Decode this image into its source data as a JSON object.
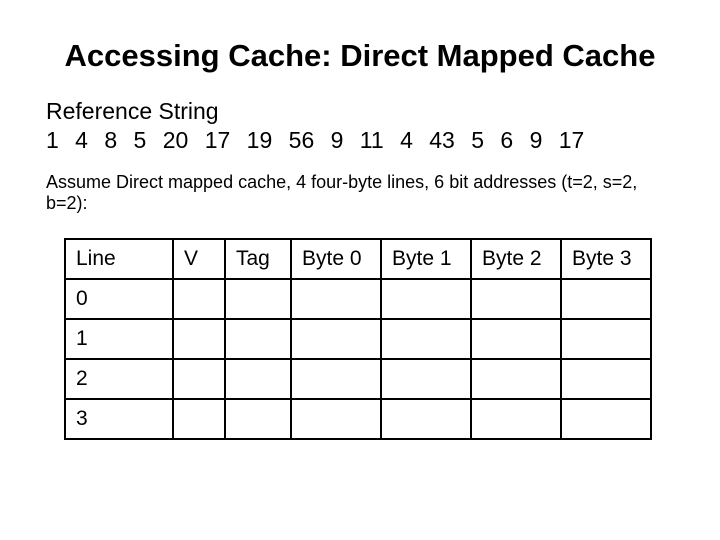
{
  "title": "Accessing Cache: Direct Mapped Cache",
  "reference": {
    "label": "Reference String",
    "values": "1  4  8  5  20  17  19  56  9  11  4  43  5  6  9  17"
  },
  "assume": "Assume Direct mapped cache, 4 four-byte lines, 6 bit addresses (t=2, s=2, b=2):",
  "table": {
    "headers": {
      "line": "Line",
      "v": "V",
      "tag": "Tag",
      "b0": "Byte 0",
      "b1": "Byte 1",
      "b2": "Byte 2",
      "b3": "Byte 3"
    },
    "rows": [
      {
        "line": "0",
        "v": "",
        "tag": "",
        "b0": "",
        "b1": "",
        "b2": "",
        "b3": ""
      },
      {
        "line": "1",
        "v": "",
        "tag": "",
        "b0": "",
        "b1": "",
        "b2": "",
        "b3": ""
      },
      {
        "line": "2",
        "v": "",
        "tag": "",
        "b0": "",
        "b1": "",
        "b2": "",
        "b3": ""
      },
      {
        "line": "3",
        "v": "",
        "tag": "",
        "b0": "",
        "b1": "",
        "b2": "",
        "b3": ""
      }
    ]
  }
}
